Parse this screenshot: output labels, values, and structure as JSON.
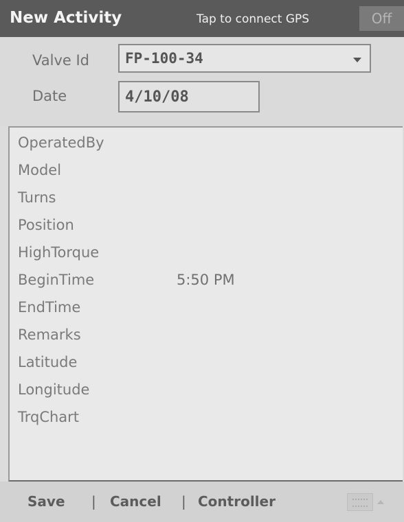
{
  "title_bar": {
    "app_title": "New Activity",
    "gps_link": "Tap to connect GPS",
    "toggle_label": "Off"
  },
  "header": {
    "valve_label": "Valve Id",
    "valve_value": "FP-100-34",
    "date_label": "Date",
    "date_value": "4/10/08"
  },
  "properties": [
    {
      "name": "OperatedBy",
      "value": ""
    },
    {
      "name": "Model",
      "value": ""
    },
    {
      "name": "Turns",
      "value": ""
    },
    {
      "name": "Position",
      "value": ""
    },
    {
      "name": "HighTorque",
      "value": ""
    },
    {
      "name": "BeginTime",
      "value": "5:50 PM"
    },
    {
      "name": "EndTime",
      "value": ""
    },
    {
      "name": "Remarks",
      "value": ""
    },
    {
      "name": "Latitude",
      "value": ""
    },
    {
      "name": "Longitude",
      "value": ""
    },
    {
      "name": "TrqChart",
      "value": ""
    }
  ],
  "menu": {
    "save": "Save",
    "cancel": "Cancel",
    "controller": "Controller",
    "separator": "|"
  },
  "icons": {
    "dropdown": "chevron-down-icon",
    "keyboard": "keyboard-icon"
  }
}
